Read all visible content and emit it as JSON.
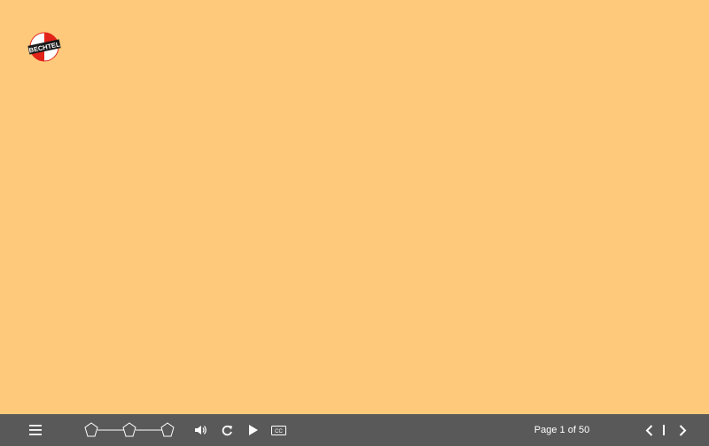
{
  "brand": {
    "logo_text": "BECHTEL",
    "logo_colors": {
      "red": "#E2231A",
      "black": "#1a1a1a",
      "white": "#ffffff"
    }
  },
  "colors": {
    "background": "#FFC97B",
    "toolbar": "#595959",
    "toolbar_icon": "#ffffff"
  },
  "toolbar": {
    "menu_icon": "hamburger-icon",
    "progress_icon": "progress-nodes-icon",
    "volume_icon": "volume-icon",
    "replay_icon": "replay-icon",
    "play_icon": "play-icon",
    "cc_label": "CC",
    "page_indicator": "Page 1 of 50",
    "prev_icon": "chevron-left-icon",
    "next_icon": "chevron-right-icon"
  }
}
